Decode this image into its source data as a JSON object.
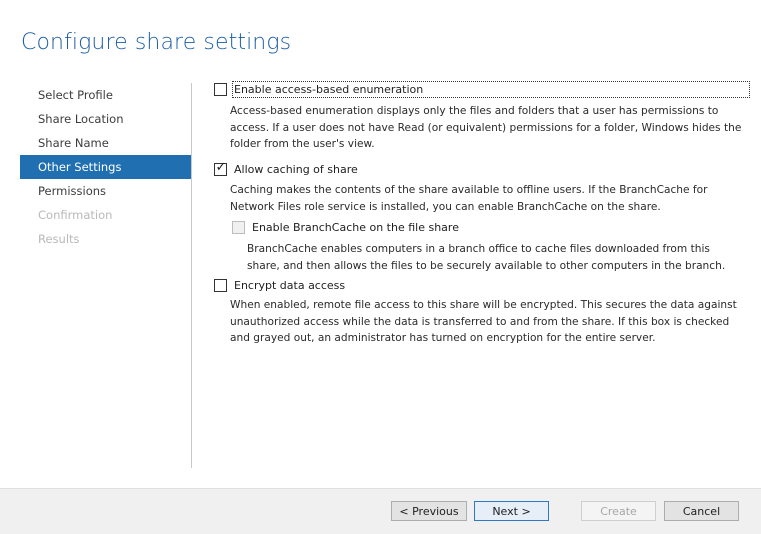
{
  "page": {
    "title": "Configure share settings"
  },
  "sidebar": {
    "items": [
      {
        "label": "Select Profile",
        "state": "normal"
      },
      {
        "label": "Share Location",
        "state": "normal"
      },
      {
        "label": "Share Name",
        "state": "normal"
      },
      {
        "label": "Other Settings",
        "state": "active"
      },
      {
        "label": "Permissions",
        "state": "normal"
      },
      {
        "label": "Confirmation",
        "state": "disabled"
      },
      {
        "label": "Results",
        "state": "disabled"
      }
    ]
  },
  "options": {
    "abe": {
      "label": "Enable access-based enumeration",
      "checked": false,
      "description": "Access-based enumeration displays only the files and folders that a user has permissions to access. If a user does not have Read (or equivalent) permissions for a folder, Windows hides the folder from the user's view."
    },
    "caching": {
      "label": "Allow caching of share",
      "checked": true,
      "description": "Caching makes the contents of the share available to offline users. If the BranchCache for Network Files role service is installed, you can enable BranchCache on the share."
    },
    "branchcache": {
      "label": "Enable BranchCache on the file share",
      "checked": false,
      "disabled": true,
      "description": "BranchCache enables computers in a branch office to cache files downloaded from this share, and then allows the files to be securely available to other computers in the branch."
    },
    "encrypt": {
      "label": "Encrypt data access",
      "checked": false,
      "description": "When enabled, remote file access to this share will be encrypted. This secures the data against unauthorized access while the data is transferred to and from the share. If this box is checked and grayed out, an administrator has turned on encryption for the entire server."
    }
  },
  "buttons": {
    "previous": "< Previous",
    "next": "Next >",
    "create": "Create",
    "cancel": "Cancel"
  },
  "colors": {
    "accent": "#1f6fb1",
    "title": "#1e5ea6"
  }
}
